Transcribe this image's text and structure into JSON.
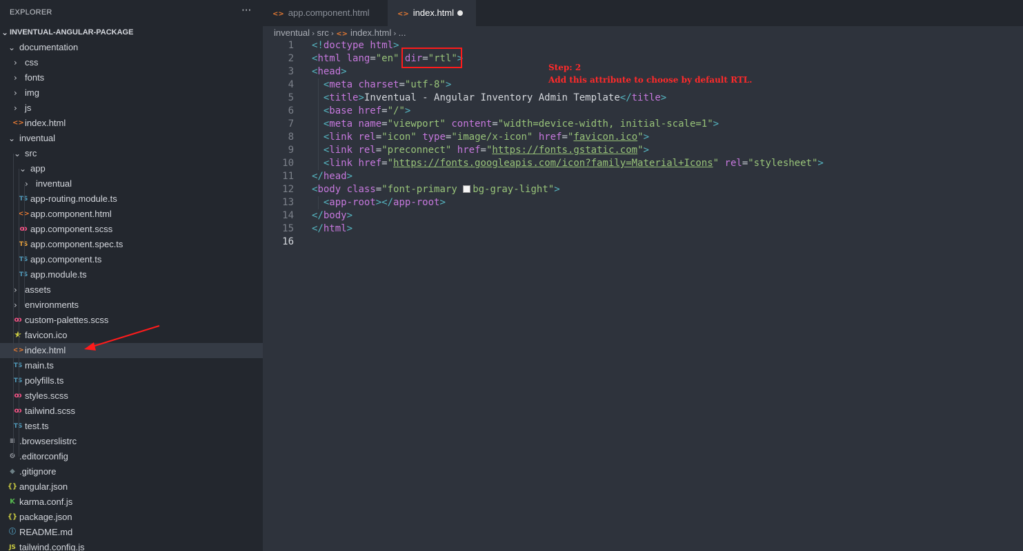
{
  "sidebar": {
    "title": "EXPLORER",
    "more": "···",
    "tree": [
      {
        "label": "INVENTUAL-ANGULAR-PACKAGE",
        "chev": "⌄",
        "root": true
      },
      {
        "label": "documentation",
        "chev": "⌄"
      },
      {
        "label": "css",
        "chev": "›"
      },
      {
        "label": "fonts",
        "chev": "›"
      },
      {
        "label": "img",
        "chev": "›"
      },
      {
        "label": "js",
        "chev": "›"
      },
      {
        "label": "index.html",
        "icon": "html-icon",
        "glyph": "<>"
      },
      {
        "label": "inventual",
        "chev": "⌄"
      },
      {
        "label": "src",
        "chev": "⌄"
      },
      {
        "label": "app",
        "chev": "⌄"
      },
      {
        "label": "inventual",
        "chev": "›"
      },
      {
        "label": "app-routing.module.ts",
        "icon": "typescript-icon",
        "glyph": "TS"
      },
      {
        "label": "app.component.html",
        "icon": "html-icon",
        "glyph": "<>"
      },
      {
        "label": "app.component.scss",
        "icon": "sass-icon",
        "glyph": "ꝏ"
      },
      {
        "label": "app.component.spec.ts",
        "icon": "typescript-spec-icon",
        "glyph": "TS"
      },
      {
        "label": "app.component.ts",
        "icon": "typescript-icon",
        "glyph": "TS"
      },
      {
        "label": "app.module.ts",
        "icon": "typescript-icon",
        "glyph": "TS"
      },
      {
        "label": "assets",
        "chev": "›"
      },
      {
        "label": "environments",
        "chev": "›"
      },
      {
        "label": "custom-palettes.scss",
        "icon": "sass-icon",
        "glyph": "ꝏ"
      },
      {
        "label": "favicon.ico",
        "icon": "star-icon",
        "glyph": "★"
      },
      {
        "label": "index.html",
        "icon": "html-icon",
        "glyph": "<>",
        "selected": true
      },
      {
        "label": "main.ts",
        "icon": "typescript-icon",
        "glyph": "TS"
      },
      {
        "label": "polyfills.ts",
        "icon": "typescript-icon",
        "glyph": "TS"
      },
      {
        "label": "styles.scss",
        "icon": "sass-icon",
        "glyph": "ꝏ"
      },
      {
        "label": "tailwind.scss",
        "icon": "sass-icon",
        "glyph": "ꝏ"
      },
      {
        "label": "test.ts",
        "icon": "typescript-icon",
        "glyph": "TS"
      },
      {
        "label": ".browserslistrc",
        "icon": "lines-icon",
        "glyph": "≡"
      },
      {
        "label": ".editorconfig",
        "icon": "gear-icon",
        "glyph": "⚙"
      },
      {
        "label": ".gitignore",
        "icon": "git-icon",
        "glyph": "◆"
      },
      {
        "label": "angular.json",
        "icon": "json-icon",
        "glyph": "{}"
      },
      {
        "label": "karma.conf.js",
        "icon": "karma-icon",
        "glyph": "K"
      },
      {
        "label": "package.json",
        "icon": "json-icon",
        "glyph": "{}"
      },
      {
        "label": "README.md",
        "icon": "info-icon",
        "glyph": "ⓘ"
      },
      {
        "label": "tailwind.config.js",
        "icon": "javascript-icon",
        "glyph": "JS"
      }
    ]
  },
  "tabs": [
    {
      "label": "app.component.html",
      "icon": "html-icon",
      "glyph": "<>"
    },
    {
      "label": "index.html",
      "icon": "html-icon",
      "glyph": "<>",
      "active": true,
      "modified": true
    }
  ],
  "breadcrumb": {
    "parts": [
      "inventual",
      "src",
      "index.html",
      "..."
    ],
    "sep": "›",
    "file_glyph": "<>"
  },
  "editor": {
    "lines": [
      "1",
      "2",
      "3",
      "4",
      "5",
      "6",
      "7",
      "8",
      "9",
      "10",
      "11",
      "12",
      "13",
      "14",
      "15",
      "16"
    ]
  },
  "annotation": {
    "step": "Step: 2",
    "text": "Add this attribute to choose by default RTL."
  },
  "colors": {
    "highlight": "#ff1b1b",
    "annotation": "#ff2a2a",
    "tag": "#c678dd",
    "string": "#98c379",
    "bracket": "#56b6c2"
  }
}
